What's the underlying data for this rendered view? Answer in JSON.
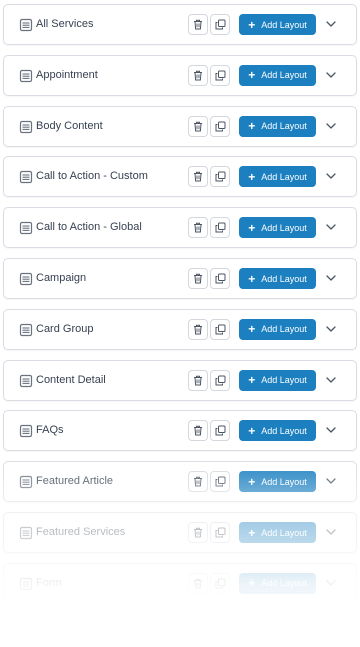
{
  "layouts": [
    {
      "label": "All Services",
      "icon": "document-icon"
    },
    {
      "label": "Appointment",
      "icon": "document-icon"
    },
    {
      "label": "Body Content",
      "icon": "document-icon"
    },
    {
      "label": "Call to Action - Custom",
      "icon": "document-icon"
    },
    {
      "label": "Call to Action - Global",
      "icon": "document-icon"
    },
    {
      "label": "Campaign",
      "icon": "document-icon"
    },
    {
      "label": "Card Group",
      "icon": "document-icon"
    },
    {
      "label": "Content Detail",
      "icon": "document-icon"
    },
    {
      "label": "FAQs",
      "icon": "document-icon"
    },
    {
      "label": "Featured Article",
      "icon": "document-icon"
    },
    {
      "label": "Featured Services",
      "icon": "document-icon"
    },
    {
      "label": "Form",
      "icon": "document-icon"
    },
    {
      "label": "",
      "icon": "document-icon"
    }
  ],
  "actions": {
    "add_label": "Add Layout",
    "delete_icon": "trash-icon",
    "duplicate_icon": "copy-icon",
    "expand_icon": "chevron-down-icon"
  },
  "colors": {
    "accent": "#1b7fc0",
    "border": "#d9dde3",
    "text": "#374151",
    "icon": "#6b7280"
  }
}
